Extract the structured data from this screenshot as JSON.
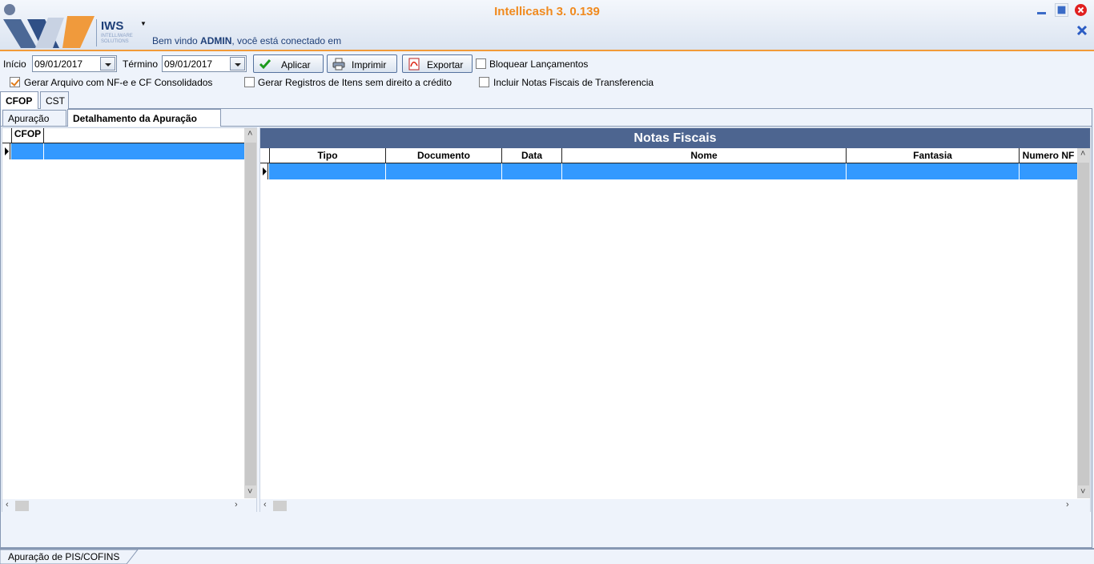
{
  "header": {
    "app_title": "Intellicash 3. 0.139",
    "brand_name": "IWS",
    "brand_sub": "INTELLIWARE SOLUTIONS",
    "welcome_prefix": "Bem vindo ",
    "welcome_user": "ADMIN",
    "welcome_suffix": ", você está conectado em"
  },
  "filters": {
    "inicio_label": "Início",
    "inicio_value": "09/01/2017",
    "termino_label": "Término",
    "termino_value": "09/01/2017",
    "aplicar_label": "Aplicar",
    "imprimir_label": "Imprimir",
    "exportar_label": "Exportar",
    "bloquear_label": "Bloquear Lançamentos",
    "bloquear_checked": false,
    "gerar_arquivo_label": "Gerar Arquivo com NF-e e CF Consolidados",
    "gerar_arquivo_checked": true,
    "gerar_registros_label": "Gerar Registros de Itens sem direito a crédito",
    "gerar_registros_checked": false,
    "incluir_notas_label": "Incluir Notas Fiscais de Transferencia",
    "incluir_notas_checked": false
  },
  "tabs": {
    "outer": [
      {
        "label": "CFOP",
        "active": true
      },
      {
        "label": "CST",
        "active": false
      }
    ],
    "inner": [
      {
        "label": "Apuração",
        "active": false
      },
      {
        "label": "Detalhamento da Apuração",
        "active": true
      }
    ]
  },
  "left_grid": {
    "columns": [
      "CFOP"
    ]
  },
  "right_grid": {
    "title": "Notas Fiscais",
    "columns": [
      "Tipo",
      "Documento",
      "Data",
      "Nome",
      "Fantasia",
      "Numero NF"
    ]
  },
  "status_tab": "Apuração de PIS/COFINS",
  "colors": {
    "accent_orange": "#f08a1e",
    "selection_blue": "#3399ff",
    "title_bar_blue": "#4d6590"
  }
}
